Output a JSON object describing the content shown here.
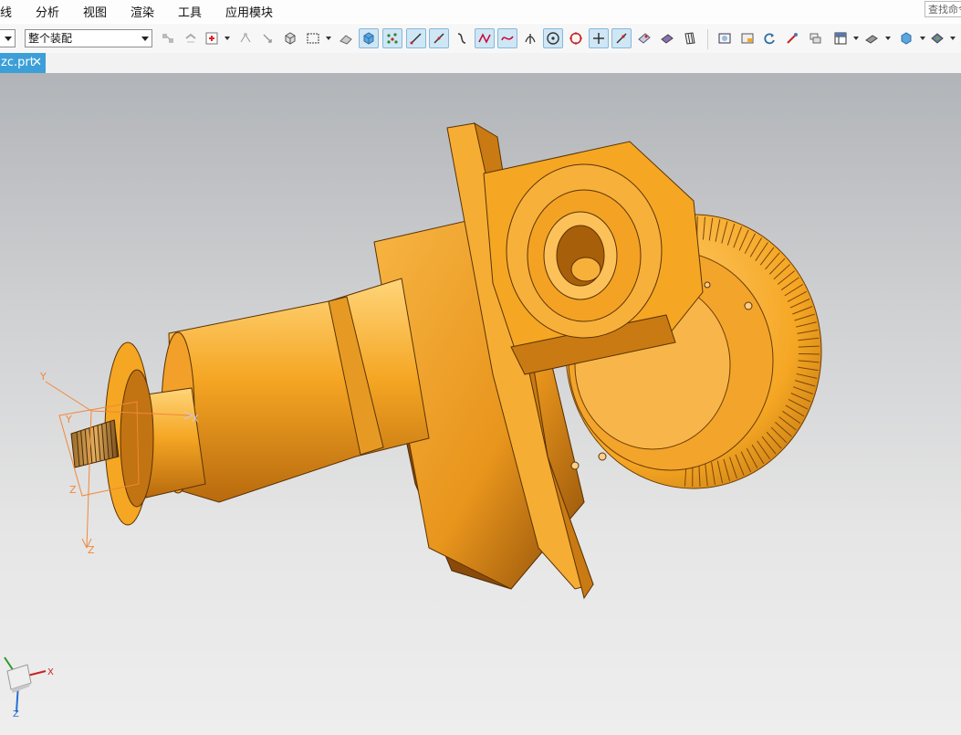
{
  "menu": {
    "items": [
      "线",
      "分析",
      "视图",
      "渲染",
      "工具",
      "应用模块"
    ],
    "search_placeholder": "查找命令"
  },
  "toolbar": {
    "selection_filter": "",
    "assembly_scope": "整个装配"
  },
  "tabs": [
    {
      "label": "zc.prt",
      "close": "✕"
    }
  ],
  "viewport": {
    "csys_labels": {
      "x": "X",
      "y": "Y",
      "z": "Z"
    },
    "triad_labels": {
      "x": "X",
      "y": "Y",
      "z": "Z"
    },
    "model_color": "#f5a623"
  },
  "colors": {
    "tab_active": "#3c9fd8",
    "toolbar_active": "#cfe6f5",
    "csys_orange": "#f0883a"
  }
}
